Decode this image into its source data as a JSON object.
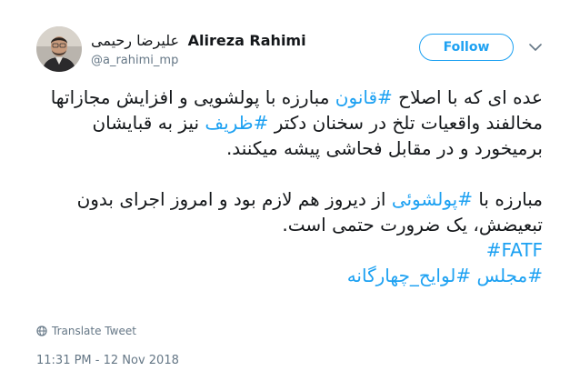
{
  "author": {
    "display_name_fa": "علیرضا رحیمی",
    "display_name_en": "Alireza Rahimi",
    "handle": "@a_rahimi_mp"
  },
  "follow_button": {
    "label": "Follow"
  },
  "tweet": {
    "p1_a": "عده ای که با اصلاح ",
    "p1_tag1": "#قانون",
    "p1_b": " مبارزه با پولشویی و افزایش مجازاتها مخالفند واقعیات تلخ در سخنان دکتر ",
    "p1_tag2": "#ظریف",
    "p1_c": " نیز به قبایشان برمیخورد و در مقابل فحاشی پیشه میکنند.",
    "p2_a": "مبارزه با ",
    "p2_tag": "#پولشوئی",
    "p2_b": " از دیروز هم لازم بود و امروز اجرای بدون تبعیضش، یک ضرورت حتمی است.",
    "tag_fatf": "#FATF",
    "tag_last": "#مجلس #لوایح_چهارگانه"
  },
  "translate_label": "Translate Tweet",
  "timestamp": "11:31 PM - 12 Nov 2018",
  "colors": {
    "accent": "#1da1f2",
    "text": "#14171a",
    "muted": "#657786"
  }
}
